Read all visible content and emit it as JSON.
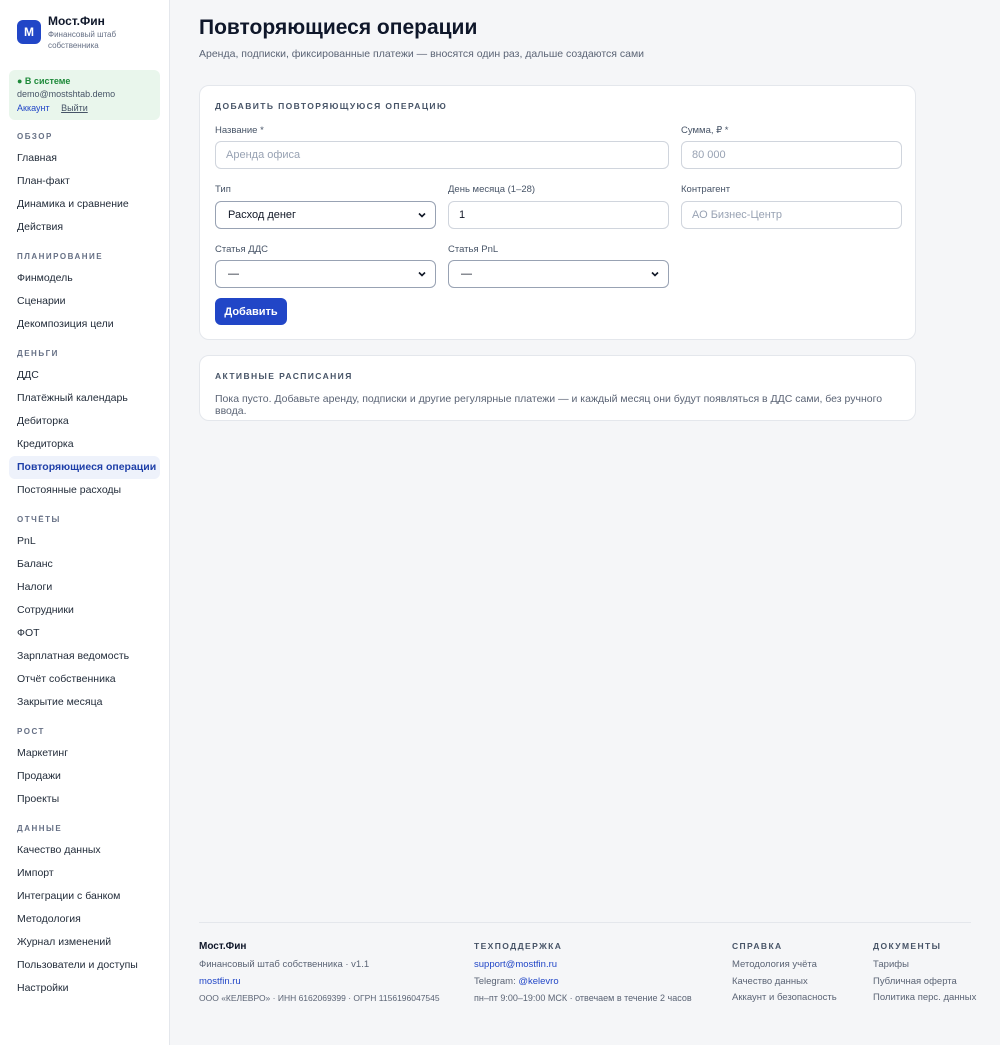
{
  "brand": {
    "logo_letter": "М",
    "name": "Мост.Фин",
    "subtitle": "Финансовый штаб собственника"
  },
  "session": {
    "status": "● В системе",
    "email": "demo@mostshtab.demo",
    "account_link": "Аккаунт",
    "logout_link": "Выйти"
  },
  "nav": {
    "overview": {
      "title": "ОБЗОР",
      "items": [
        "Главная",
        "План-факт",
        "Динамика и сравнение",
        "Действия"
      ]
    },
    "planning": {
      "title": "ПЛАНИРОВАНИЕ",
      "items": [
        "Финмодель",
        "Сценарии",
        "Декомпозиция цели"
      ]
    },
    "money": {
      "title": "ДЕНЬГИ",
      "items": [
        "ДДС",
        "Платёжный календарь",
        "Дебиторка",
        "Кредиторка",
        "Повторяющиеся операции",
        "Постоянные расходы"
      ]
    },
    "reports": {
      "title": "ОТЧЁТЫ",
      "items": [
        "PnL",
        "Баланс",
        "Налоги",
        "Сотрудники",
        "ФОТ",
        "Зарплатная ведомость",
        "Отчёт собственника",
        "Закрытие месяца"
      ]
    },
    "growth": {
      "title": "РОСТ",
      "items": [
        "Маркетинг",
        "Продажи",
        "Проекты"
      ]
    },
    "data": {
      "title": "ДАННЫЕ",
      "items": [
        "Качество данных",
        "Импорт",
        "Интеграции с банком",
        "Методология",
        "Журнал изменений",
        "Пользователи и доступы",
        "Настройки"
      ]
    }
  },
  "page": {
    "title": "Повторяющиеся операции",
    "subtitle": "Аренда, подписки, фиксированные платежи — вносятся один раз, дальше создаются сами"
  },
  "form": {
    "title": "ДОБАВИТЬ ПОВТОРЯЮЩУЮСЯ ОПЕРАЦИЮ",
    "name_label": "Название *",
    "name_placeholder": "Аренда офиса",
    "amount_label": "Сумма, ₽ *",
    "amount_placeholder": "80 000",
    "type_label": "Тип",
    "type_value": "Расход денег",
    "day_label": "День месяца (1–28)",
    "day_value": "1",
    "counterparty_label": "Контрагент",
    "counterparty_placeholder": "АО Бизнес-Центр",
    "dds_label": "Статья ДДС",
    "dds_value": "—",
    "pnl_label": "Статья PnL",
    "pnl_value": "—",
    "submit": "Добавить"
  },
  "active": {
    "title": "АКТИВНЫЕ РАСПИСАНИЯ",
    "empty": "Пока пусто. Добавьте аренду, подписки и другие регулярные платежи — и каждый месяц они будут появляться в ДДС сами, без ручного ввода."
  },
  "footer": {
    "brand": "Мост.Фин",
    "tagline": "Финансовый штаб собственника · v1.1",
    "site": "mostfin.ru",
    "legal": "ООО «КЕЛЕВРО» · ИНН 6162069399 · ОГРН 1156196047545",
    "support_title": "ТЕХПОДДЕРЖКА",
    "support_email": "support@mostfin.ru",
    "telegram_label": "Telegram:",
    "telegram_handle": "@kelevro",
    "hours": "пн–пт 9:00–19:00 МСК · отвечаем в течение 2 часов",
    "help_title": "СПРАВКА",
    "help_links": [
      "Методология учёта",
      "Качество данных",
      "Аккаунт и безопасность"
    ],
    "docs_title": "ДОКУМЕНТЫ",
    "docs_links": [
      "Тарифы",
      "Публичная оферта",
      "Политика перс. данных"
    ]
  },
  "colors": {
    "accent": "#2146c7",
    "active_nav_bg": "#eef2fb",
    "session_bg": "#e9f6ec",
    "status_green": "#1e8a3a"
  }
}
